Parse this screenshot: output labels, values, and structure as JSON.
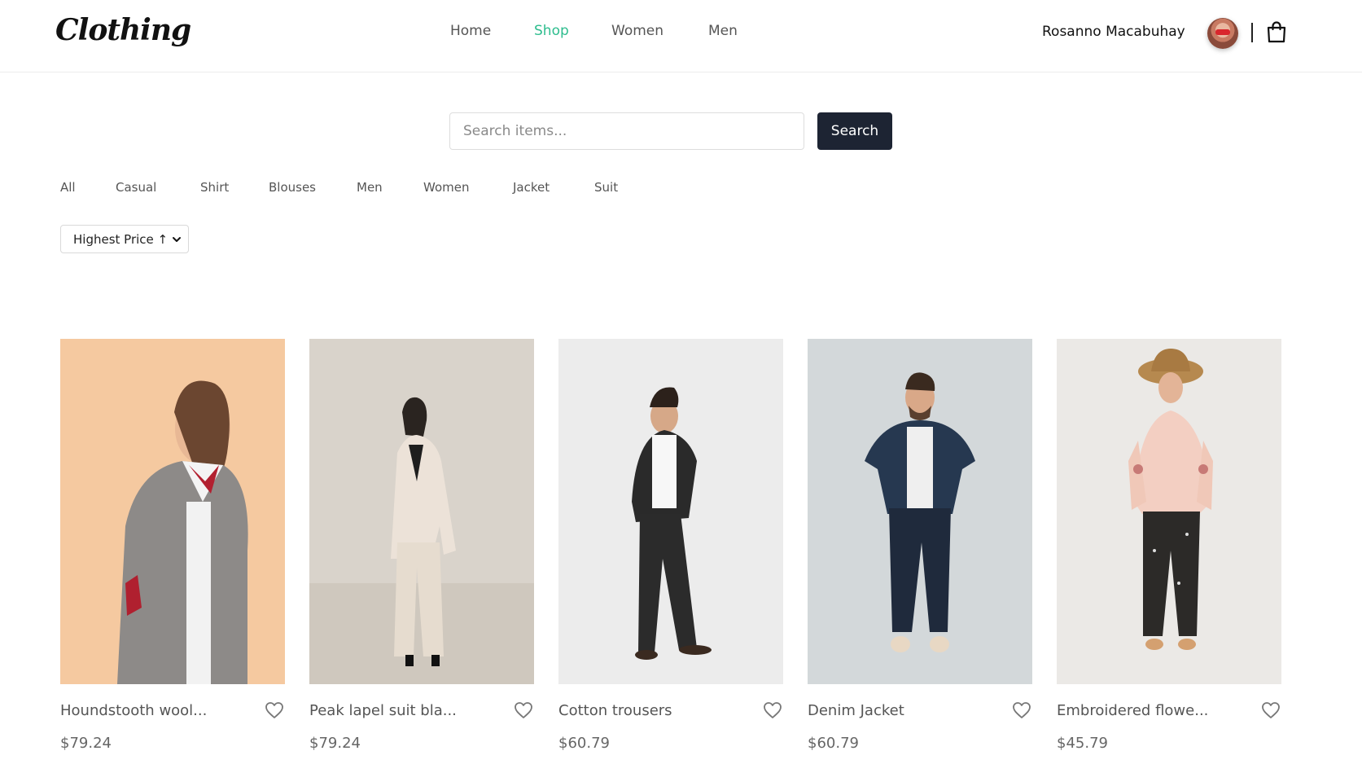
{
  "header": {
    "logo": "Clothing",
    "nav": [
      {
        "label": "Home",
        "active": false
      },
      {
        "label": "Shop",
        "active": true
      },
      {
        "label": "Women",
        "active": false
      },
      {
        "label": "Men",
        "active": false
      }
    ],
    "user_name": "Rosanno Macabuhay",
    "avatar_icon": "user-avatar",
    "cart_icon": "shopping-bag-icon"
  },
  "search": {
    "placeholder": "Search items...",
    "value": "",
    "button_label": "Search"
  },
  "filters": [
    "All",
    "Casual",
    "Shirt",
    "Blouses",
    "Men",
    "Women",
    "Jacket",
    "Suit"
  ],
  "sort": {
    "selected": "Highest Price ↑"
  },
  "products": [
    {
      "title": "Houndstooth wool...",
      "price": "$79.24",
      "favorite_icon": "heart-icon"
    },
    {
      "title": "Peak lapel suit bla...",
      "price": "$79.24",
      "favorite_icon": "heart-icon"
    },
    {
      "title": "Cotton trousers",
      "price": "$60.79",
      "favorite_icon": "heart-icon"
    },
    {
      "title": "Denim Jacket",
      "price": "$60.79",
      "favorite_icon": "heart-icon"
    },
    {
      "title": "Embroidered flowe...",
      "price": "$45.79",
      "favorite_icon": "heart-icon"
    }
  ],
  "colors": {
    "accent": "#2ebd8e",
    "button_dark": "#1d2433",
    "text_muted": "#555555"
  }
}
